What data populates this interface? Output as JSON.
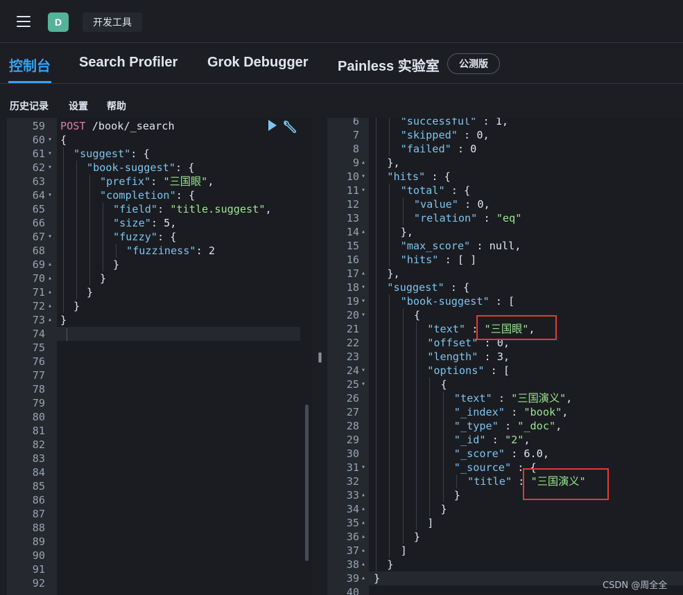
{
  "header": {
    "avatar_letter": "D",
    "breadcrumb": "开发工具"
  },
  "tabs": [
    {
      "label": "控制台",
      "active": true
    },
    {
      "label": "Search Profiler",
      "active": false
    },
    {
      "label": "Grok Debugger",
      "active": false
    },
    {
      "label": "Painless 实验室",
      "active": false
    }
  ],
  "beta_badge": "公测版",
  "toolbar": {
    "history": "历史记录",
    "settings": "设置",
    "help": "帮助"
  },
  "left_editor": {
    "request_method": "POST",
    "request_path": " /book/_search",
    "lines": [
      {
        "n": "59",
        "fold": false,
        "indent": 0,
        "code": []
      },
      {
        "n": "60",
        "fold": "▾",
        "indent": 0,
        "code": [
          [
            "p",
            "{"
          ]
        ]
      },
      {
        "n": "61",
        "fold": "▾",
        "indent": 1,
        "code": [
          [
            "k",
            "\"suggest\""
          ],
          [
            "p",
            ": {"
          ]
        ]
      },
      {
        "n": "62",
        "fold": "▾",
        "indent": 2,
        "code": [
          [
            "k",
            "\"book-suggest\""
          ],
          [
            "p",
            ": {"
          ]
        ]
      },
      {
        "n": "63",
        "fold": false,
        "indent": 3,
        "code": [
          [
            "k",
            "\"prefix\""
          ],
          [
            "p",
            ": "
          ],
          [
            "s",
            "\"三国眼\""
          ],
          [
            "p",
            ","
          ]
        ]
      },
      {
        "n": "64",
        "fold": "▾",
        "indent": 3,
        "code": [
          [
            "k",
            "\"completion\""
          ],
          [
            "p",
            ": {"
          ]
        ]
      },
      {
        "n": "65",
        "fold": false,
        "indent": 4,
        "code": [
          [
            "k",
            "\"field\""
          ],
          [
            "p",
            ": "
          ],
          [
            "s",
            "\"title.suggest\""
          ],
          [
            "p",
            ","
          ]
        ]
      },
      {
        "n": "66",
        "fold": false,
        "indent": 4,
        "code": [
          [
            "k",
            "\"size\""
          ],
          [
            "p",
            ": 5,"
          ]
        ]
      },
      {
        "n": "67",
        "fold": "▾",
        "indent": 4,
        "code": [
          [
            "k",
            "\"fuzzy\""
          ],
          [
            "p",
            ": {"
          ]
        ]
      },
      {
        "n": "68",
        "fold": false,
        "indent": 5,
        "code": [
          [
            "k",
            "\"fuzziness\""
          ],
          [
            "p",
            ": 2"
          ]
        ]
      },
      {
        "n": "69",
        "fold": "▴",
        "indent": 4,
        "code": [
          [
            "p",
            "}"
          ]
        ]
      },
      {
        "n": "70",
        "fold": "▴",
        "indent": 3,
        "code": [
          [
            "p",
            "}"
          ]
        ]
      },
      {
        "n": "71",
        "fold": "▴",
        "indent": 2,
        "code": [
          [
            "p",
            "}"
          ]
        ]
      },
      {
        "n": "72",
        "fold": "▴",
        "indent": 1,
        "code": [
          [
            "p",
            "}"
          ]
        ]
      },
      {
        "n": "73",
        "fold": "▴",
        "indent": 0,
        "code": [
          [
            "p",
            "}"
          ]
        ]
      },
      {
        "n": "74",
        "fold": false,
        "indent": 0,
        "code": []
      },
      {
        "n": "75",
        "fold": false,
        "indent": 0,
        "code": []
      },
      {
        "n": "76",
        "fold": false,
        "indent": 0,
        "code": []
      },
      {
        "n": "77",
        "fold": false,
        "indent": 0,
        "code": []
      },
      {
        "n": "78",
        "fold": false,
        "indent": 0,
        "code": []
      },
      {
        "n": "79",
        "fold": false,
        "indent": 0,
        "code": []
      },
      {
        "n": "80",
        "fold": false,
        "indent": 0,
        "code": []
      },
      {
        "n": "81",
        "fold": false,
        "indent": 0,
        "code": []
      },
      {
        "n": "82",
        "fold": false,
        "indent": 0,
        "code": []
      },
      {
        "n": "83",
        "fold": false,
        "indent": 0,
        "code": []
      },
      {
        "n": "84",
        "fold": false,
        "indent": 0,
        "code": []
      },
      {
        "n": "85",
        "fold": false,
        "indent": 0,
        "code": []
      },
      {
        "n": "86",
        "fold": false,
        "indent": 0,
        "code": []
      },
      {
        "n": "87",
        "fold": false,
        "indent": 0,
        "code": []
      },
      {
        "n": "88",
        "fold": false,
        "indent": 0,
        "code": []
      },
      {
        "n": "89",
        "fold": false,
        "indent": 0,
        "code": []
      },
      {
        "n": "90",
        "fold": false,
        "indent": 0,
        "code": []
      },
      {
        "n": "91",
        "fold": false,
        "indent": 0,
        "code": []
      },
      {
        "n": "92",
        "fold": false,
        "indent": 0,
        "code": []
      }
    ]
  },
  "right_editor": {
    "lines": [
      {
        "n": "6",
        "fold": false,
        "indent": 2,
        "code": [
          [
            "k",
            "\"successful\""
          ],
          [
            "p",
            " : 1,"
          ]
        ]
      },
      {
        "n": "7",
        "fold": false,
        "indent": 2,
        "code": [
          [
            "k",
            "\"skipped\""
          ],
          [
            "p",
            " : 0,"
          ]
        ]
      },
      {
        "n": "8",
        "fold": false,
        "indent": 2,
        "code": [
          [
            "k",
            "\"failed\""
          ],
          [
            "p",
            " : 0"
          ]
        ]
      },
      {
        "n": "9",
        "fold": "▴",
        "indent": 1,
        "code": [
          [
            "p",
            "},"
          ]
        ]
      },
      {
        "n": "10",
        "fold": "▾",
        "indent": 1,
        "code": [
          [
            "k",
            "\"hits\""
          ],
          [
            "p",
            " : {"
          ]
        ]
      },
      {
        "n": "11",
        "fold": "▾",
        "indent": 2,
        "code": [
          [
            "k",
            "\"total\""
          ],
          [
            "p",
            " : {"
          ]
        ]
      },
      {
        "n": "12",
        "fold": false,
        "indent": 3,
        "code": [
          [
            "k",
            "\"value\""
          ],
          [
            "p",
            " : 0,"
          ]
        ]
      },
      {
        "n": "13",
        "fold": false,
        "indent": 3,
        "code": [
          [
            "k",
            "\"relation\""
          ],
          [
            "p",
            " : "
          ],
          [
            "s",
            "\"eq\""
          ]
        ]
      },
      {
        "n": "14",
        "fold": "▴",
        "indent": 2,
        "code": [
          [
            "p",
            "},"
          ]
        ]
      },
      {
        "n": "15",
        "fold": false,
        "indent": 2,
        "code": [
          [
            "k",
            "\"max_score\""
          ],
          [
            "p",
            " : null,"
          ]
        ]
      },
      {
        "n": "16",
        "fold": false,
        "indent": 2,
        "code": [
          [
            "k",
            "\"hits\""
          ],
          [
            "p",
            " : [ ]"
          ]
        ]
      },
      {
        "n": "17",
        "fold": "▴",
        "indent": 1,
        "code": [
          [
            "p",
            "},"
          ]
        ]
      },
      {
        "n": "18",
        "fold": "▾",
        "indent": 1,
        "code": [
          [
            "k",
            "\"suggest\""
          ],
          [
            "p",
            " : {"
          ]
        ]
      },
      {
        "n": "19",
        "fold": "▾",
        "indent": 2,
        "code": [
          [
            "k",
            "\"book-suggest\""
          ],
          [
            "p",
            " : ["
          ]
        ]
      },
      {
        "n": "20",
        "fold": "▾",
        "indent": 3,
        "code": [
          [
            "p",
            "{"
          ]
        ]
      },
      {
        "n": "21",
        "fold": false,
        "indent": 4,
        "code": [
          [
            "k",
            "\"text\""
          ],
          [
            "p",
            " : "
          ],
          [
            "s",
            "\"三国眼\""
          ],
          [
            "p",
            ","
          ]
        ]
      },
      {
        "n": "22",
        "fold": false,
        "indent": 4,
        "code": [
          [
            "k",
            "\"offset\""
          ],
          [
            "p",
            " : 0,"
          ]
        ]
      },
      {
        "n": "23",
        "fold": false,
        "indent": 4,
        "code": [
          [
            "k",
            "\"length\""
          ],
          [
            "p",
            " : 3,"
          ]
        ]
      },
      {
        "n": "24",
        "fold": "▾",
        "indent": 4,
        "code": [
          [
            "k",
            "\"options\""
          ],
          [
            "p",
            " : ["
          ]
        ]
      },
      {
        "n": "25",
        "fold": "▾",
        "indent": 5,
        "code": [
          [
            "p",
            "{"
          ]
        ]
      },
      {
        "n": "26",
        "fold": false,
        "indent": 6,
        "code": [
          [
            "k",
            "\"text\""
          ],
          [
            "p",
            " : "
          ],
          [
            "s",
            "\"三国演义\""
          ],
          [
            "p",
            ","
          ]
        ]
      },
      {
        "n": "27",
        "fold": false,
        "indent": 6,
        "code": [
          [
            "k",
            "\"_index\""
          ],
          [
            "p",
            " : "
          ],
          [
            "s",
            "\"book\""
          ],
          [
            "p",
            ","
          ]
        ]
      },
      {
        "n": "28",
        "fold": false,
        "indent": 6,
        "code": [
          [
            "k",
            "\"_type\""
          ],
          [
            "p",
            " : "
          ],
          [
            "s",
            "\"_doc\""
          ],
          [
            "p",
            ","
          ]
        ]
      },
      {
        "n": "29",
        "fold": false,
        "indent": 6,
        "code": [
          [
            "k",
            "\"_id\""
          ],
          [
            "p",
            " : "
          ],
          [
            "s",
            "\"2\""
          ],
          [
            "p",
            ","
          ]
        ]
      },
      {
        "n": "30",
        "fold": false,
        "indent": 6,
        "code": [
          [
            "k",
            "\"_score\""
          ],
          [
            "p",
            " : 6.0,"
          ]
        ]
      },
      {
        "n": "31",
        "fold": "▾",
        "indent": 6,
        "code": [
          [
            "k",
            "\"_source\""
          ],
          [
            "p",
            " : {"
          ]
        ]
      },
      {
        "n": "32",
        "fold": false,
        "indent": 7,
        "code": [
          [
            "k",
            "\"title\""
          ],
          [
            "p",
            " : "
          ],
          [
            "s",
            "\"三国演义\""
          ]
        ]
      },
      {
        "n": "33",
        "fold": "▴",
        "indent": 6,
        "code": [
          [
            "p",
            "}"
          ]
        ]
      },
      {
        "n": "34",
        "fold": "▴",
        "indent": 5,
        "code": [
          [
            "p",
            "}"
          ]
        ]
      },
      {
        "n": "35",
        "fold": "▴",
        "indent": 4,
        "code": [
          [
            "p",
            "]"
          ]
        ]
      },
      {
        "n": "36",
        "fold": "▴",
        "indent": 3,
        "code": [
          [
            "p",
            "}"
          ]
        ]
      },
      {
        "n": "37",
        "fold": "▴",
        "indent": 2,
        "code": [
          [
            "p",
            "]"
          ]
        ]
      },
      {
        "n": "38",
        "fold": "▴",
        "indent": 1,
        "code": [
          [
            "p",
            "}"
          ]
        ]
      },
      {
        "n": "39",
        "fold": "▴",
        "indent": 0,
        "code": [
          [
            "p",
            "}"
          ]
        ]
      },
      {
        "n": "40",
        "fold": false,
        "indent": 0,
        "code": []
      }
    ]
  },
  "icons": {
    "run": "play-icon",
    "wrench": "wrench-icon",
    "menu": "hamburger-icon"
  },
  "colors": {
    "accent": "#36a2ef",
    "key": "#7dc4ef",
    "string": "#9ae68f",
    "method": "#e47ba8",
    "highlight_box": "#e53935"
  },
  "watermark": "CSDN @周全全"
}
